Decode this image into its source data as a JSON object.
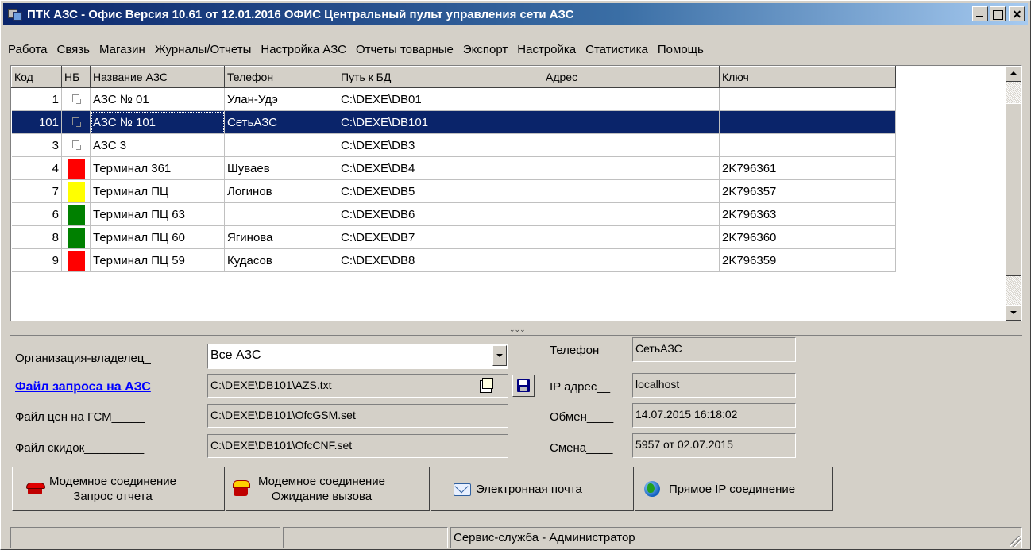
{
  "window": {
    "title": "ПТК АЗС - Офис Версия 10.61 от 12.01.2016 ОФИС Центральный пульт управления сети АЗС"
  },
  "menu": [
    "Работа",
    "Связь",
    "Магазин",
    "Журналы/Отчеты",
    "Настройка АЗС",
    "Отчеты товарные",
    "Экспорт",
    "Настройка",
    "Статистика",
    "Помощь"
  ],
  "grid": {
    "columns": [
      "Код",
      "НБ",
      "Название АЗС",
      "Телефон",
      "Путь к БД",
      "Адрес",
      "Ключ"
    ],
    "rows": [
      {
        "code": "1",
        "nb": "pc-icon",
        "name": "АЗС № 01",
        "phone": "Улан-Удэ",
        "path": "C:\\DEXE\\DB01",
        "address": "",
        "key": ""
      },
      {
        "code": "101",
        "nb": "pc-icon",
        "name": "АЗС № 101",
        "phone": "СетьАЗС",
        "path": "C:\\DEXE\\DB101",
        "address": "",
        "key": "",
        "selected": true
      },
      {
        "code": "3",
        "nb": "pc-icon",
        "name": "АЗС 3",
        "phone": "",
        "path": "C:\\DEXE\\DB3",
        "address": "",
        "key": ""
      },
      {
        "code": "4",
        "nb": "red",
        "name": "Терминал 361",
        "phone": "Шуваев",
        "path": "C:\\DEXE\\DB4",
        "address": "",
        "key": "2K796361"
      },
      {
        "code": "7",
        "nb": "yellow",
        "name": "Терминал ПЦ",
        "phone": "Логинов",
        "path": "C:\\DEXE\\DB5",
        "address": "",
        "key": "2K796357"
      },
      {
        "code": "6",
        "nb": "green",
        "name": "Терминал ПЦ 63",
        "phone": "",
        "path": "C:\\DEXE\\DB6",
        "address": "",
        "key": "2K796363"
      },
      {
        "code": "8",
        "nb": "green",
        "name": "Терминал ПЦ 60",
        "phone": "Ягинова",
        "path": "C:\\DEXE\\DB7",
        "address": "",
        "key": "2K796360"
      },
      {
        "code": "9",
        "nb": "red",
        "name": "Терминал ПЦ 59",
        "phone": "Кудасов",
        "path": "C:\\DEXE\\DB8",
        "address": "",
        "key": "2K796359"
      }
    ]
  },
  "form": {
    "owner_label": "Организация-владелец_",
    "owner_value": "Все АЗС",
    "request_file_label": "Файл запроса на АЗС",
    "request_file_value": "C:\\DEXE\\DB101\\AZS.txt",
    "price_file_label": "Файл цен на ГСМ_____",
    "price_file_value": "C:\\DEXE\\DB101\\OfcGSM.set",
    "discount_file_label": "Файл скидок_________",
    "discount_file_value": "C:\\DEXE\\DB101\\OfcCNF.set",
    "phone_label": "Телефон__",
    "phone_value": "СетьАЗС",
    "ip_label": "IP адрес__",
    "ip_value": "localhost",
    "exchange_label": "Обмен____",
    "exchange_value": "14.07.2015 16:18:02",
    "shift_label": "Смена____",
    "shift_value": "5957 от 02.07.2015"
  },
  "buttons": {
    "modem_request": [
      "Модемное соединение",
      "Запрос отчета"
    ],
    "modem_wait": [
      "Модемное соединение",
      "Ожидание вызова"
    ],
    "email": "Электронная почта",
    "direct_ip": "Прямое IP соединение"
  },
  "status": {
    "panel1": "",
    "panel2": "",
    "panel3": "Сервис-служба - Администратор"
  },
  "colors": {
    "selection": "#0a246a",
    "status_red": "#ff0000",
    "status_yellow": "#ffff00",
    "status_green": "#008000",
    "link": "#0000ff"
  }
}
